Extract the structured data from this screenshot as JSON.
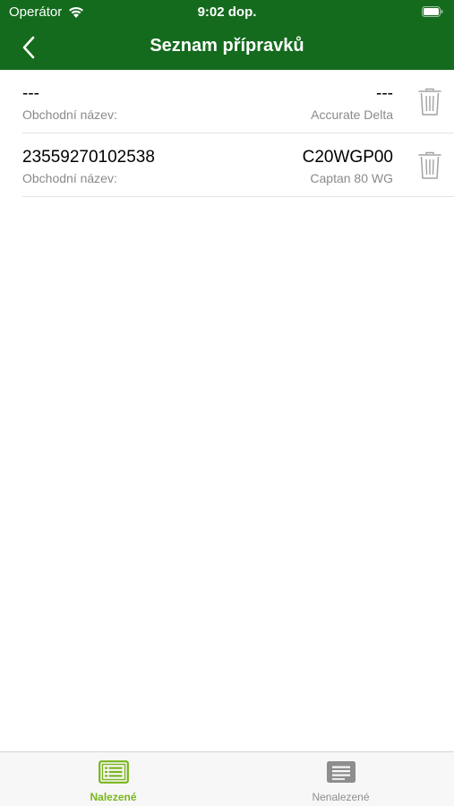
{
  "status_bar": {
    "carrier": "Operátor",
    "time": "9:02 dop."
  },
  "nav": {
    "title": "Seznam přípravků"
  },
  "list": {
    "items": [
      {
        "code": "---",
        "right_main": "---",
        "label": "Obchodní název:",
        "trade_name": "Accurate Delta"
      },
      {
        "code": "23559270102538",
        "right_main": "C20WGP00",
        "label": "Obchodní název:",
        "trade_name": "Captan 80 WG"
      }
    ]
  },
  "tabs": [
    {
      "label": "Nalezené",
      "icon": "list-icon",
      "active": true
    },
    {
      "label": "Nenalezené",
      "icon": "list-icon",
      "active": false
    }
  ],
  "colors": {
    "header": "#146b1d",
    "tab_active": "#7ab51d",
    "tab_inactive": "#8e8e8e",
    "trash_icon": "#a3a3a3"
  }
}
